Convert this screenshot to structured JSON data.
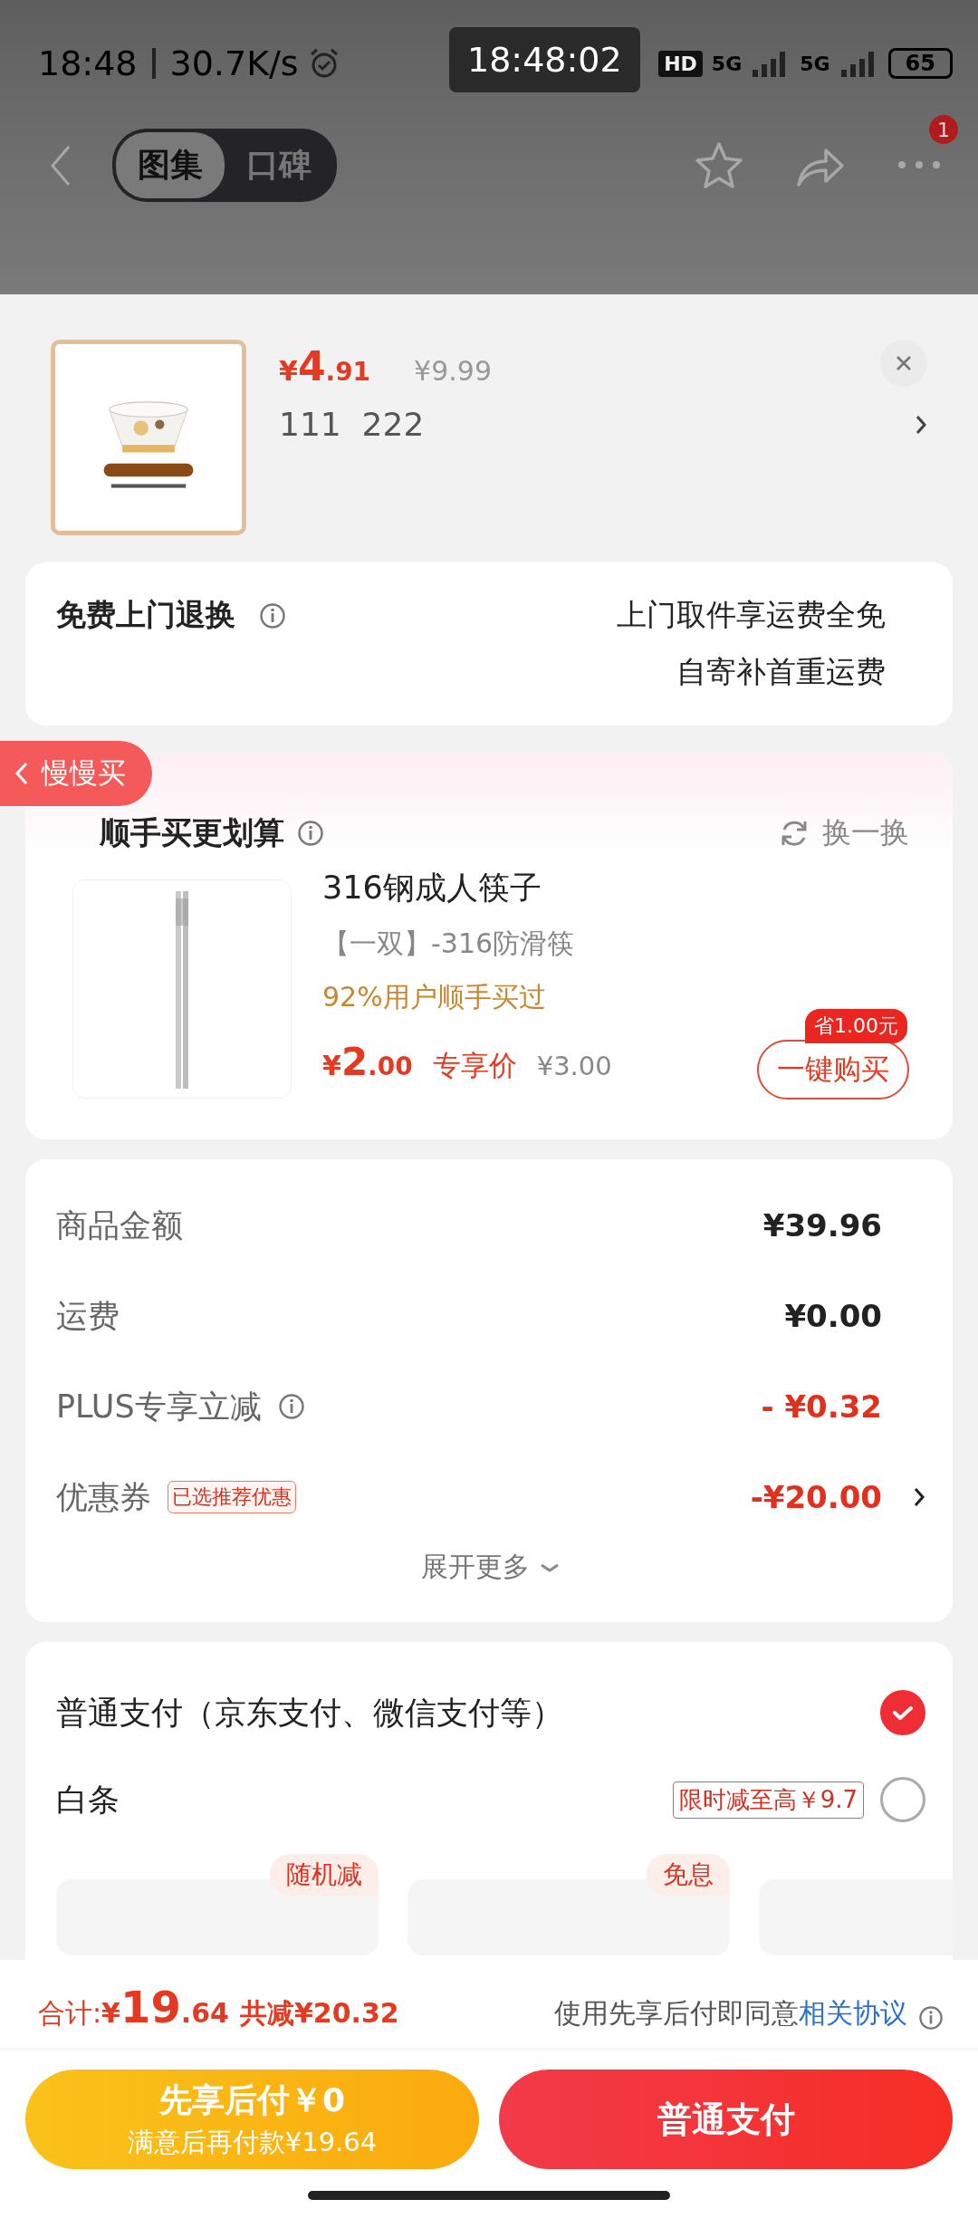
{
  "status_bar": {
    "time": "18:48",
    "speed": "30.7K/s",
    "hd_badge": "HD",
    "network_1": "5G",
    "network_2": "5G",
    "battery": "65"
  },
  "clock_overlay": "18:48:02",
  "nav": {
    "tabs": [
      {
        "label": "图集",
        "selected": true
      },
      {
        "label": "口碑",
        "selected": false
      }
    ],
    "notification_count": "1"
  },
  "product": {
    "price_symbol": "¥",
    "price_int": "4",
    "price_dec": ".91",
    "original_price": "¥9.99",
    "spec": "111  222"
  },
  "return_service": {
    "title": "免费上门退换",
    "lines": [
      "上门取件享运费全免",
      "自寄补首重运费"
    ]
  },
  "floating_tab": {
    "label": "慢慢买"
  },
  "bundle": {
    "title": "顺手买更划算",
    "refresh": "换一换",
    "item": {
      "name": "316钢成人筷子",
      "variant": "【一双】-316防滑筷",
      "social": "92%用户顺手买过",
      "price_symbol": "¥",
      "price_int": "2",
      "price_dec": ".00",
      "price_tag": "专享价",
      "original_price": "¥3.00",
      "save_badge": "省1.00元",
      "buy_button": "一键购买"
    }
  },
  "summary": {
    "rows": [
      {
        "label": "商品金额",
        "value": "¥39.96",
        "kind": "plain"
      },
      {
        "label": "运费",
        "value": "¥0.00",
        "kind": "plain"
      },
      {
        "label": "PLUS专享立减",
        "value": "- ¥0.32",
        "kind": "discount",
        "info": true
      },
      {
        "label": "优惠券",
        "value": "-¥20.00",
        "kind": "discount",
        "tag": "已选推荐优惠",
        "arrow": true
      }
    ],
    "expand": "展开更多"
  },
  "payment": {
    "methods": [
      {
        "label": "普通支付（京东支付、微信支付等）",
        "selected": true
      },
      {
        "label": "白条",
        "promo": "限时减至高￥9.7",
        "selected": false
      }
    ],
    "installments": [
      {
        "kind": "badged",
        "badge": "随机减"
      },
      {
        "kind": "badged",
        "badge": "免息"
      },
      {
        "kind": "plain"
      }
    ]
  },
  "footer": {
    "total_label": "合计:",
    "total_symbol": "¥",
    "total_int": "19",
    "total_dec": ".64",
    "saved": "共减¥20.32",
    "agreement_text": "使用先享后付即同意",
    "agreement_link": "相关协议",
    "later_button": {
      "title": "先享后付￥0",
      "subtitle": "满意后再付款¥19.64"
    },
    "pay_button": "普通支付"
  }
}
